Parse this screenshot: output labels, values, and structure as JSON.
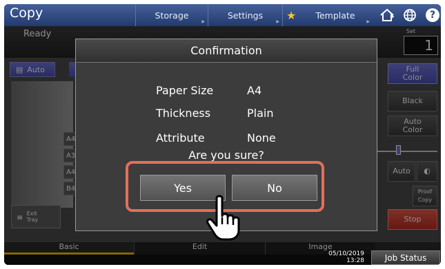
{
  "topbar": {
    "app_title": "Copy",
    "tabs": {
      "storage": "Storage",
      "settings": "Settings",
      "template": "Template"
    },
    "icons": [
      "home-icon",
      "globe-icon",
      "help-icon"
    ],
    "help_glyph": "?"
  },
  "status": {
    "text": "Ready",
    "set_label": "Set",
    "set_value": "1"
  },
  "background": {
    "auto_label": "Auto",
    "trays": [
      "A4",
      "A3",
      "A4",
      "B4"
    ],
    "exit_tray": "Exit\nTray",
    "color_buttons": {
      "full_color": "Full\nColor",
      "black": "Black",
      "auto_color": "Auto\nColor"
    },
    "density_auto": "Auto",
    "proof_copy": "Proof\nCopy",
    "stop": "Stop"
  },
  "bottom_tabs": {
    "basic": "Basic",
    "edit": "Edit",
    "image": "Image"
  },
  "footer": {
    "date": "05/10/2019",
    "time": "13:28",
    "job_status": "Job Status"
  },
  "dialog": {
    "title": "Confirmation",
    "rows": [
      {
        "label": "Paper Size",
        "value": "A4"
      },
      {
        "label": "Thickness",
        "value": "Plain"
      },
      {
        "label": "Attribute",
        "value": "None"
      }
    ],
    "question": "Are you sure?",
    "yes": "Yes",
    "no": "No"
  },
  "colors": {
    "topbar": "#2f4a82",
    "highlight_frame": "#e46f57",
    "stop": "#d2453a",
    "accent": "#5b61c8"
  }
}
